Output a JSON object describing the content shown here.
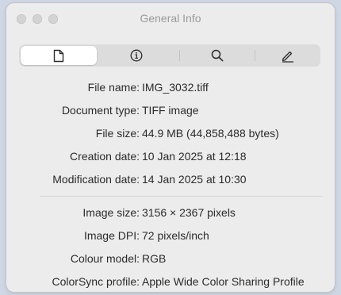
{
  "window": {
    "title": "General Info"
  },
  "tabs": [
    {
      "name": "document",
      "icon": "document-icon",
      "active": true
    },
    {
      "name": "info",
      "icon": "info-icon",
      "active": false
    },
    {
      "name": "search",
      "icon": "magnifier-icon",
      "active": false
    },
    {
      "name": "annotate",
      "icon": "pencil-icon",
      "active": false
    }
  ],
  "file_info": [
    {
      "label": "File name:",
      "value": "IMG_3032.tiff"
    },
    {
      "label": "Document type:",
      "value": "TIFF image"
    },
    {
      "label": "File size:",
      "value": "44.9 MB (44,858,488 bytes)"
    },
    {
      "label": "Creation date:",
      "value": "10 Jan 2025 at 12:18"
    },
    {
      "label": "Modification date:",
      "value": "14 Jan 2025 at 10:30"
    }
  ],
  "image_info": [
    {
      "label": "Image size:",
      "value": "3156 × 2367 pixels"
    },
    {
      "label": "Image DPI:",
      "value": "72 pixels/inch"
    },
    {
      "label": "Colour model:",
      "value": "RGB"
    },
    {
      "label": "ColorSync profile:",
      "value": "Apple Wide Color Sharing Profile"
    }
  ]
}
